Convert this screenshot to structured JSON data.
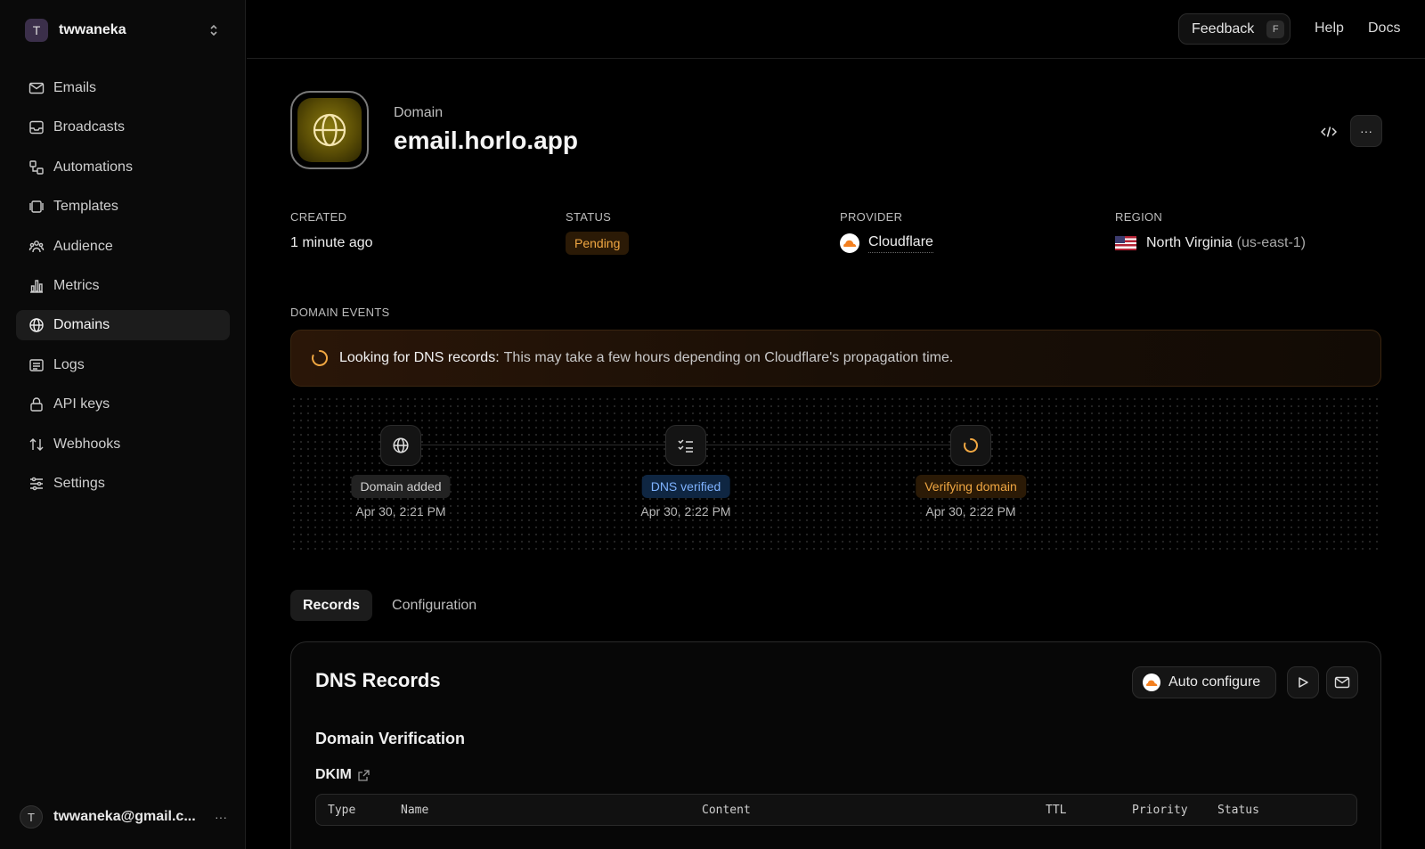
{
  "workspace": {
    "initial": "T",
    "name": "twwaneka"
  },
  "sidebar": {
    "items": [
      {
        "label": "Emails",
        "icon": "mail-icon"
      },
      {
        "label": "Broadcasts",
        "icon": "inbox-icon"
      },
      {
        "label": "Automations",
        "icon": "automation-icon"
      },
      {
        "label": "Templates",
        "icon": "templates-icon"
      },
      {
        "label": "Audience",
        "icon": "audience-icon"
      },
      {
        "label": "Metrics",
        "icon": "bar-chart-icon"
      },
      {
        "label": "Domains",
        "icon": "globe-icon",
        "active": true
      },
      {
        "label": "Logs",
        "icon": "logs-icon"
      },
      {
        "label": "API keys",
        "icon": "lock-icon"
      },
      {
        "label": "Webhooks",
        "icon": "webhook-icon"
      },
      {
        "label": "Settings",
        "icon": "sliders-icon"
      }
    ]
  },
  "user": {
    "initial": "T",
    "email": "twwaneka@gmail.c...",
    "more": "···"
  },
  "topbar": {
    "feedback": "Feedback",
    "feedback_key": "F",
    "help": "Help",
    "docs": "Docs"
  },
  "domain": {
    "label": "Domain",
    "name": "email.horlo.app",
    "more": "···"
  },
  "meta": {
    "created_label": "CREATED",
    "created_value": "1 minute ago",
    "status_label": "STATUS",
    "status_value": "Pending",
    "provider_label": "PROVIDER",
    "provider_value": "Cloudflare",
    "region_label": "REGION",
    "region_value": "North Virginia",
    "region_code": "(us-east-1)"
  },
  "events": {
    "label": "DOMAIN EVENTS",
    "alert_strong": "Looking for DNS records:",
    "alert_text": "This may take a few hours depending on Cloudflare's propagation time.",
    "steps": [
      {
        "label": "Domain added",
        "time": "Apr 30, 2:21 PM"
      },
      {
        "label": "DNS verified",
        "time": "Apr 30, 2:22 PM"
      },
      {
        "label": "Verifying domain",
        "time": "Apr 30, 2:22 PM"
      }
    ]
  },
  "tabs": [
    {
      "label": "Records",
      "active": true
    },
    {
      "label": "Configuration"
    }
  ],
  "records": {
    "title": "DNS Records",
    "auto_configure": "Auto configure",
    "section_title": "Domain Verification",
    "dkim": "DKIM",
    "columns": [
      "Type",
      "Name",
      "Content",
      "TTL",
      "Priority",
      "Status"
    ]
  },
  "colors": {
    "pending_text": "#f0a742",
    "verified_bg": "#0f2642",
    "verified_text": "#7fb3ff",
    "cloudflare": "#f38020"
  }
}
